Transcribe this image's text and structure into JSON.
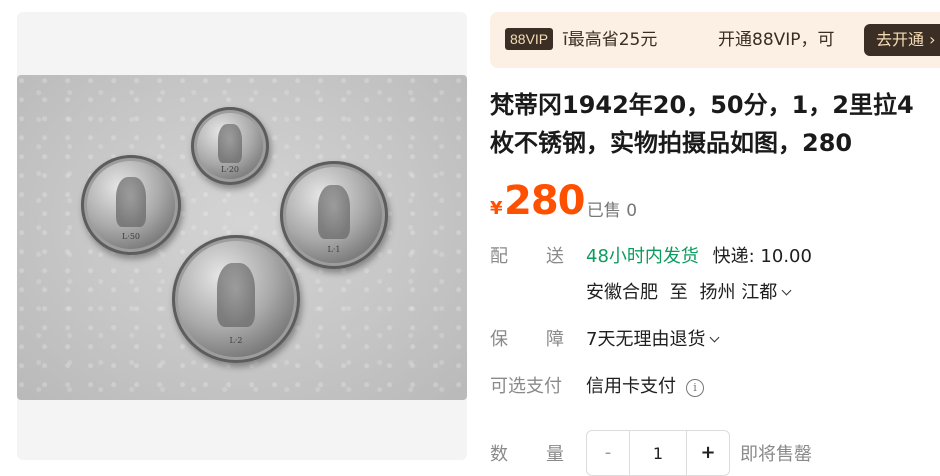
{
  "promo": {
    "badge": "88VIP",
    "save_text": "ī最高省25元",
    "open_text": "开通88VIP，可",
    "open_button": "去开通 ›"
  },
  "product": {
    "title_line1": "梵蒂冈1942年20，50分，1，2里拉4",
    "title_line2": "枚不锈钢，实物拍摄品如图，280",
    "currency": "¥",
    "price": "280",
    "sold": "· 已售 0",
    "coin_labels": [
      "L·20",
      "L·50",
      "L·1",
      "L·2"
    ]
  },
  "shipping": {
    "label_a": "配",
    "label_b": "送",
    "promise": "48小时内发货",
    "fee": "快递: 10.00",
    "from": "安徽合肥",
    "to_word": "至",
    "dest": "扬州 江都"
  },
  "guarantee": {
    "label_a": "保",
    "label_b": "障",
    "value": "7天无理由退货"
  },
  "payment": {
    "label": "可选支付",
    "value": "信用卡支付",
    "info_icon": "i"
  },
  "quantity": {
    "label_a": "数",
    "label_b": "量",
    "minus": "-",
    "value": "1",
    "plus": "+",
    "status": "即将售罄"
  }
}
